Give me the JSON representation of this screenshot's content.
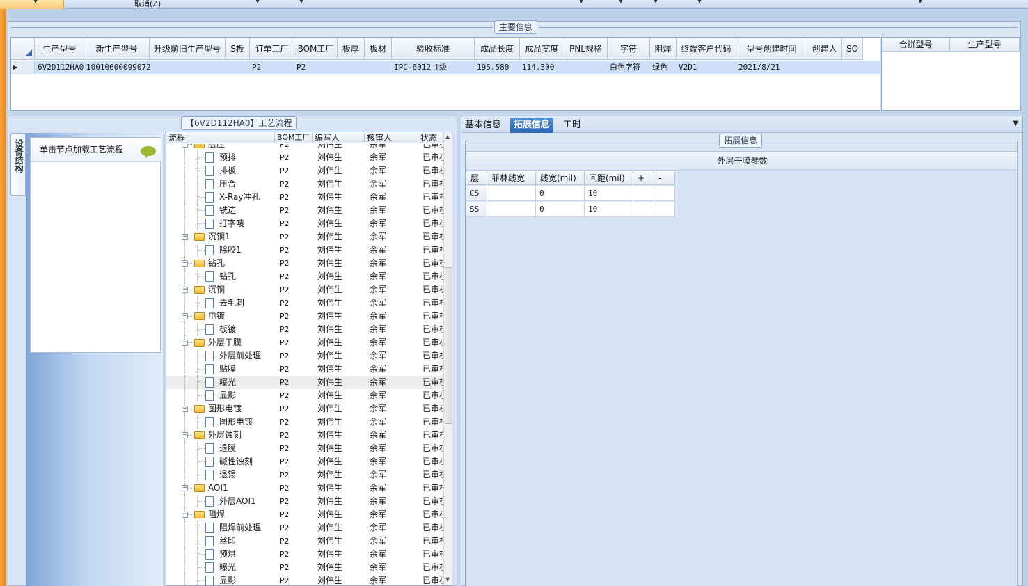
{
  "toolbar": {
    "cancel_label": "取消(Z)"
  },
  "main_info": {
    "title": "主要信息",
    "columns": [
      "生产型号",
      "新生产型号",
      "升级前旧生产型号",
      "S板",
      "订单工厂",
      "BOM工厂",
      "板厚",
      "板材",
      "验收标准",
      "成品长度",
      "成品宽度",
      "PNL规格",
      "字符",
      "阻焊",
      "终端客户代码",
      "型号创建时间",
      "创建人",
      "SO"
    ],
    "row": [
      "6V2D112HA0",
      "10010600099072",
      "",
      "",
      "P2",
      "P2",
      "",
      "",
      "IPC-6012 Ⅱ级",
      "195.580",
      "114.300",
      "",
      "白色字符",
      "绿色",
      "V2D1",
      "2021/8/21",
      "",
      ""
    ],
    "merge_columns": [
      "合拼型号",
      "生产型号"
    ]
  },
  "flow": {
    "title": "【6V2D112HA0】工艺流程",
    "side_tab": "设备结构",
    "hint": "单击节点加载工艺流程",
    "columns": [
      "流程",
      "BOM工厂",
      "编写人",
      "核审人",
      "状态"
    ],
    "rows": [
      {
        "name": "层压",
        "level": 0,
        "bom": "P2",
        "writer": "刘伟生",
        "reviewer": "余军",
        "status": "已审核"
      },
      {
        "name": "预排",
        "level": 1,
        "bom": "P2",
        "writer": "刘伟生",
        "reviewer": "余军",
        "status": "已审核"
      },
      {
        "name": "排板",
        "level": 1,
        "bom": "P2",
        "writer": "刘伟生",
        "reviewer": "余军",
        "status": "已审核"
      },
      {
        "name": "压合",
        "level": 1,
        "bom": "P2",
        "writer": "刘伟生",
        "reviewer": "余军",
        "status": "已审核"
      },
      {
        "name": "X-Ray冲孔",
        "level": 1,
        "bom": "P2",
        "writer": "刘伟生",
        "reviewer": "余军",
        "status": "已审核"
      },
      {
        "name": "铣边",
        "level": 1,
        "bom": "P2",
        "writer": "刘伟生",
        "reviewer": "余军",
        "status": "已审核"
      },
      {
        "name": "打字唛",
        "level": 1,
        "bom": "P2",
        "writer": "刘伟生",
        "reviewer": "余军",
        "status": "已审核"
      },
      {
        "name": "沉铜1",
        "level": 0,
        "bom": "P2",
        "writer": "刘伟生",
        "reviewer": "余军",
        "status": "已审核"
      },
      {
        "name": "除胶1",
        "level": 1,
        "bom": "P2",
        "writer": "刘伟生",
        "reviewer": "余军",
        "status": "已审核"
      },
      {
        "name": "钻孔",
        "level": 0,
        "bom": "P2",
        "writer": "刘伟生",
        "reviewer": "余军",
        "status": "已审核"
      },
      {
        "name": "钻孔",
        "level": 1,
        "bom": "P2",
        "writer": "刘伟生",
        "reviewer": "余军",
        "status": "已审核"
      },
      {
        "name": "沉铜",
        "level": 0,
        "bom": "P2",
        "writer": "刘伟生",
        "reviewer": "余军",
        "status": "已审核"
      },
      {
        "name": "去毛刺",
        "level": 1,
        "bom": "P2",
        "writer": "刘伟生",
        "reviewer": "余军",
        "status": "已审核"
      },
      {
        "name": "电镀",
        "level": 0,
        "bom": "P2",
        "writer": "刘伟生",
        "reviewer": "余军",
        "status": "已审核"
      },
      {
        "name": "板镀",
        "level": 1,
        "bom": "P2",
        "writer": "刘伟生",
        "reviewer": "余军",
        "status": "已审核"
      },
      {
        "name": "外层干膜",
        "level": 0,
        "bom": "P2",
        "writer": "刘伟生",
        "reviewer": "余军",
        "status": "已审核"
      },
      {
        "name": "外层前处理",
        "level": 1,
        "bom": "P2",
        "writer": "刘伟生",
        "reviewer": "余军",
        "status": "已审核"
      },
      {
        "name": "贴膜",
        "level": 1,
        "bom": "P2",
        "writer": "刘伟生",
        "reviewer": "余军",
        "status": "已审核"
      },
      {
        "name": "曝光",
        "level": 1,
        "bom": "P2",
        "writer": "刘伟生",
        "reviewer": "余军",
        "status": "已审核",
        "selected": true
      },
      {
        "name": "显影",
        "level": 1,
        "bom": "P2",
        "writer": "刘伟生",
        "reviewer": "余军",
        "status": "已审核"
      },
      {
        "name": "图形电镀",
        "level": 0,
        "bom": "P2",
        "writer": "刘伟生",
        "reviewer": "余军",
        "status": "已审核"
      },
      {
        "name": "图形电镀",
        "level": 1,
        "bom": "P2",
        "writer": "刘伟生",
        "reviewer": "余军",
        "status": "已审核"
      },
      {
        "name": "外层蚀刻",
        "level": 0,
        "bom": "P2",
        "writer": "刘伟生",
        "reviewer": "余军",
        "status": "已审核"
      },
      {
        "name": "退膜",
        "level": 1,
        "bom": "P2",
        "writer": "刘伟生",
        "reviewer": "余军",
        "status": "已审核"
      },
      {
        "name": "碱性蚀刻",
        "level": 1,
        "bom": "P2",
        "writer": "刘伟生",
        "reviewer": "余军",
        "status": "已审核"
      },
      {
        "name": "退锡",
        "level": 1,
        "bom": "P2",
        "writer": "刘伟生",
        "reviewer": "余军",
        "status": "已审核"
      },
      {
        "name": "AOI1",
        "level": 0,
        "bom": "P2",
        "writer": "刘伟生",
        "reviewer": "余军",
        "status": "已审核"
      },
      {
        "name": "外层AOI1",
        "level": 1,
        "bom": "P2",
        "writer": "刘伟生",
        "reviewer": "余军",
        "status": "已审核"
      },
      {
        "name": "阻焊",
        "level": 0,
        "bom": "P2",
        "writer": "刘伟生",
        "reviewer": "余军",
        "status": "已审核"
      },
      {
        "name": "阻焊前处理",
        "level": 1,
        "bom": "P2",
        "writer": "刘伟生",
        "reviewer": "余军",
        "status": "已审核"
      },
      {
        "name": "丝印",
        "level": 1,
        "bom": "P2",
        "writer": "刘伟生",
        "reviewer": "余军",
        "status": "已审核"
      },
      {
        "name": "预烘",
        "level": 1,
        "bom": "P2",
        "writer": "刘伟生",
        "reviewer": "余军",
        "status": "已审核"
      },
      {
        "name": "曝光",
        "level": 1,
        "bom": "P2",
        "writer": "刘伟生",
        "reviewer": "余军",
        "status": "已审核"
      },
      {
        "name": "显影",
        "level": 1,
        "bom": "P2",
        "writer": "刘伟生",
        "reviewer": "余军",
        "status": "已审核"
      }
    ]
  },
  "right": {
    "tabs": [
      "基本信息",
      "拓展信息",
      "工时"
    ],
    "active_tab": 1,
    "ext_title": "拓展信息",
    "section_caption": "外层干膜参数",
    "columns": [
      "层",
      "菲林线宽",
      "线宽(mil)",
      "间距(mil)",
      "+",
      "-"
    ],
    "rows": [
      [
        "CS",
        "",
        "0",
        "10",
        "",
        ""
      ],
      [
        "SS",
        "",
        "0",
        "10",
        "",
        ""
      ]
    ]
  },
  "colors": {
    "accent": "#2a65b4",
    "selection": "#cde0f7",
    "folder": "#f0b92c",
    "orange": "#f6a53a"
  }
}
